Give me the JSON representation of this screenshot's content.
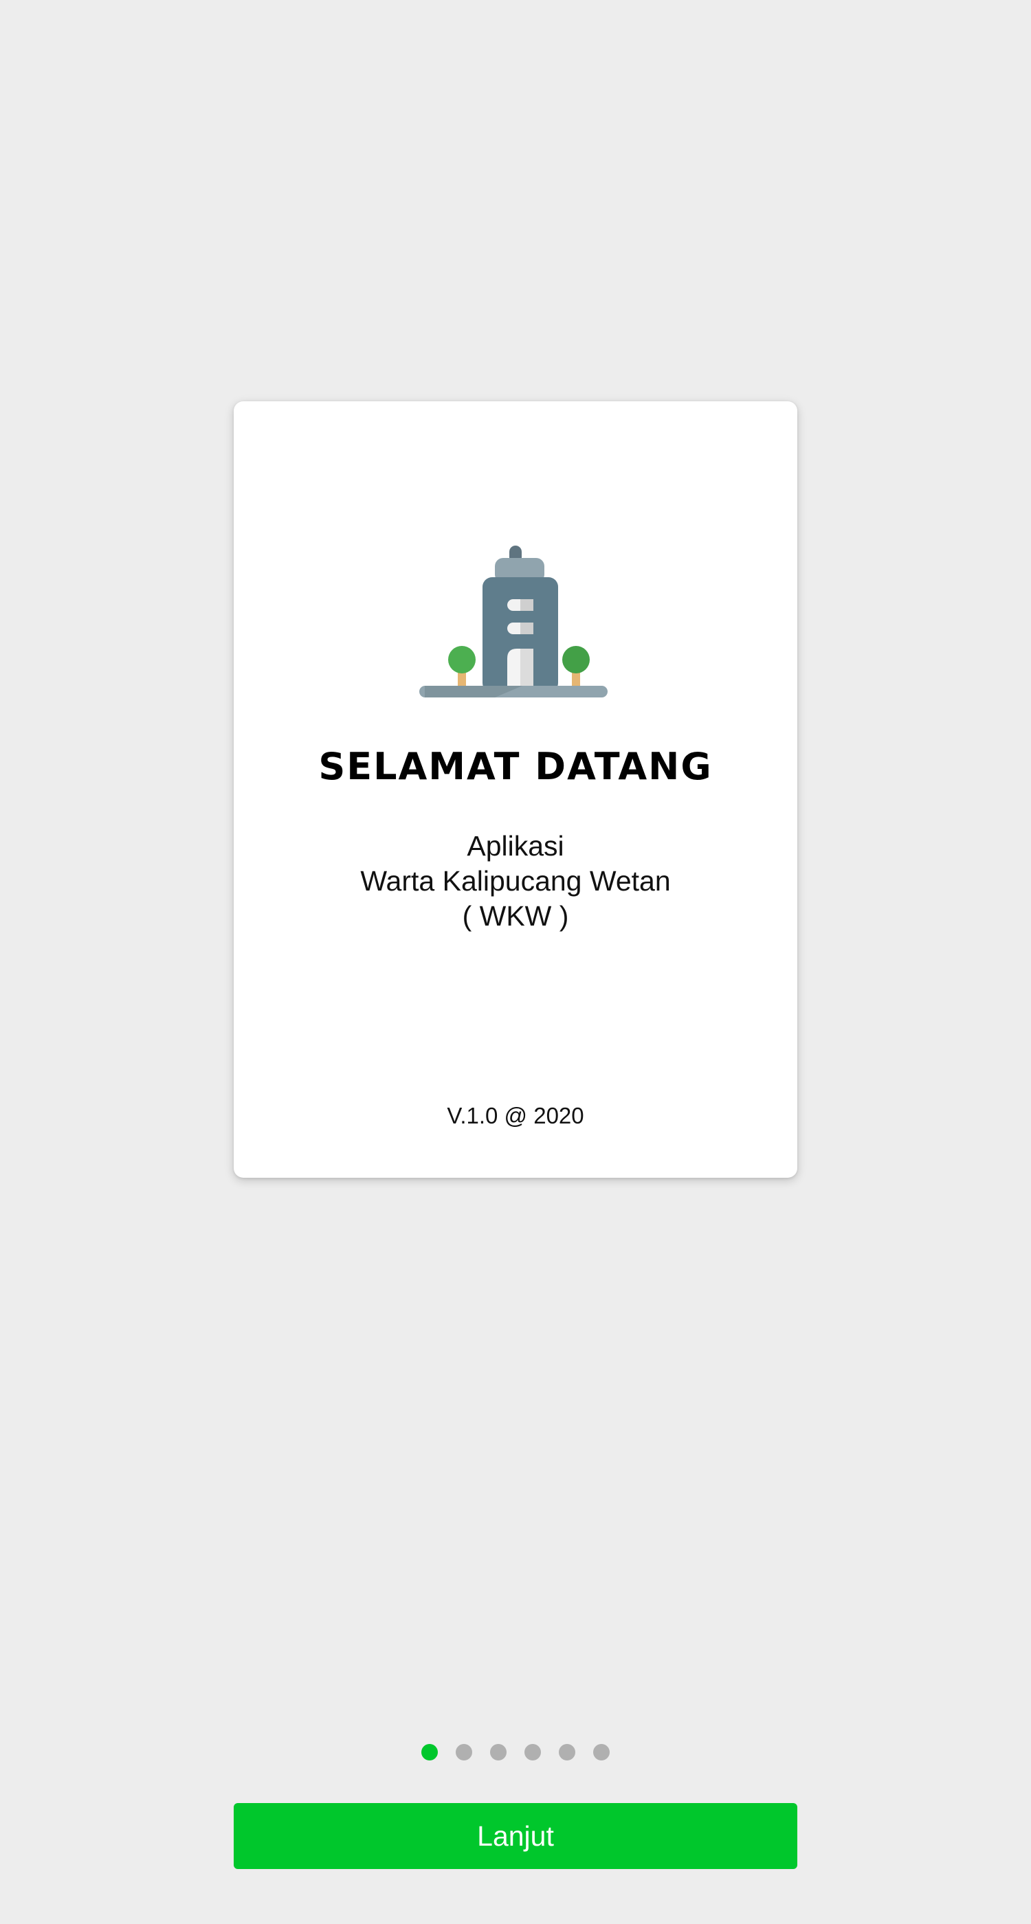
{
  "welcome": {
    "logo_icon": "building-with-trees-icon",
    "title": "SELAMAT DATANG",
    "subtitle_lines": [
      "Aplikasi",
      "Warta Kalipucang Wetan",
      "( WKW )"
    ],
    "version": "V.1.0 @ 2020"
  },
  "pagination": {
    "total": 6,
    "active_index": 0,
    "active_color": "#00c72c",
    "inactive_color": "#b0b0b0"
  },
  "actions": {
    "next_label": "Lanjut",
    "button_color": "#00c72c"
  },
  "background_color": "#ededed"
}
